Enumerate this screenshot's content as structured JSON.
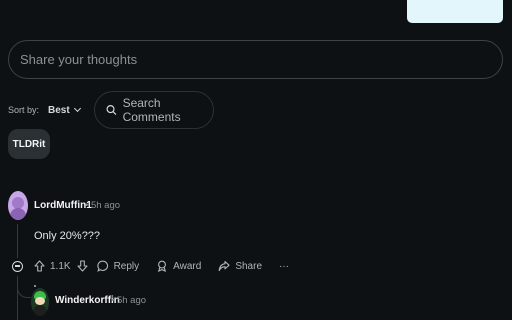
{
  "composer": {
    "placeholder": "Share your thoughts"
  },
  "sort": {
    "label": "Sort by:",
    "value": "Best"
  },
  "search": {
    "placeholder": "Search Comments"
  },
  "tldr_button": {
    "label": "TLDRit"
  },
  "comments": [
    {
      "author": "LordMuffin1",
      "meta": "• 5h ago",
      "text": "Only 20%???",
      "actions": {
        "upvotes": "1.1K",
        "reply": "Reply",
        "award": "Award",
        "share": "Share",
        "more": "···"
      }
    },
    {
      "author": "Winderkorffin",
      "meta": "• 5h ago"
    }
  ],
  "colors": {
    "background": "#0e1113",
    "top_card": "#e3f6fb",
    "muted_text": "#8a9196"
  }
}
